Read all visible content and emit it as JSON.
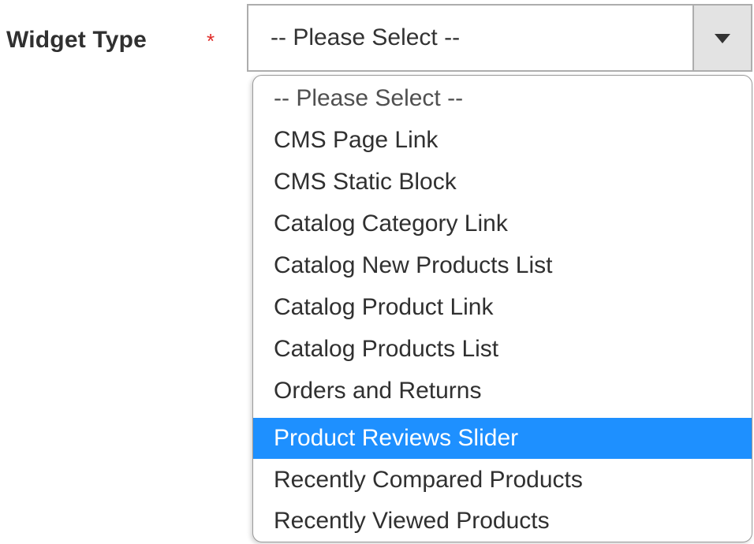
{
  "form": {
    "label": "Widget Type",
    "required_mark": "*",
    "selected_value": "-- Please Select --",
    "arrow_icon": "triangle-down-icon",
    "highlight_color": "#1e90ff",
    "required_color": "#e02b27"
  },
  "dropdown": {
    "highlighted_index": 8,
    "options": [
      "-- Please Select --",
      "CMS Page Link",
      "CMS Static Block",
      "Catalog Category Link",
      "Catalog New Products List",
      "Catalog Product Link",
      "Catalog Products List",
      "Orders and Returns",
      "Product Reviews Slider",
      "Recently Compared Products",
      "Recently Viewed Products"
    ]
  }
}
